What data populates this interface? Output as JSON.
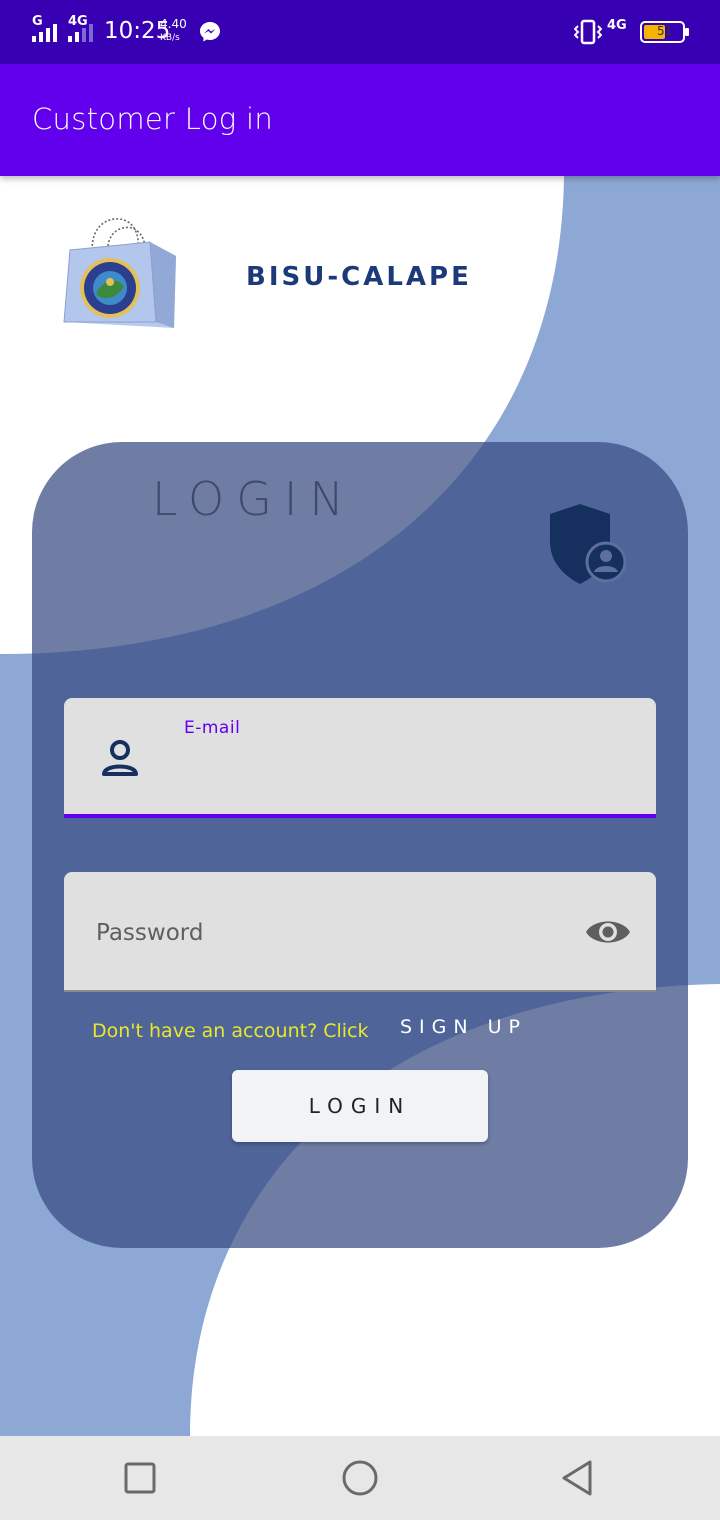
{
  "status_bar": {
    "carrier1": "G",
    "carrier2": "4G",
    "time": "10:25",
    "net_speed": "4.40",
    "net_unit": "KB/s",
    "net_type": "4G",
    "battery": "51",
    "icons": [
      "signal-icon",
      "messenger-icon",
      "vibrate-icon",
      "battery-icon"
    ]
  },
  "app_bar": {
    "title": "Customer Log in"
  },
  "header": {
    "logo": "shopping-bag-seal-logo",
    "brand": "BISU-CALAPE"
  },
  "login_card": {
    "title": "LOGIN",
    "icon": "shield-user-icon",
    "email": {
      "label": "E-mail",
      "value": "",
      "icon": "person-icon"
    },
    "password": {
      "placeholder": "Password",
      "value": "",
      "icon": "eye-icon"
    },
    "signup_prompt": "Don't have an account? Click",
    "signup_link": "SIGN UP",
    "login_button": "LOGIN"
  },
  "nav_bar": {
    "icons": [
      "recents-square-icon",
      "home-circle-icon",
      "back-triangle-icon"
    ]
  },
  "colors": {
    "status_bar": "#3700b3",
    "app_bar": "#6200ee",
    "accent": "#6200ee",
    "background_shape": "#8ea8d6",
    "card": "#5c6f9d",
    "prompt_text": "#e8e82a",
    "brand_text": "#1c3a7a"
  }
}
